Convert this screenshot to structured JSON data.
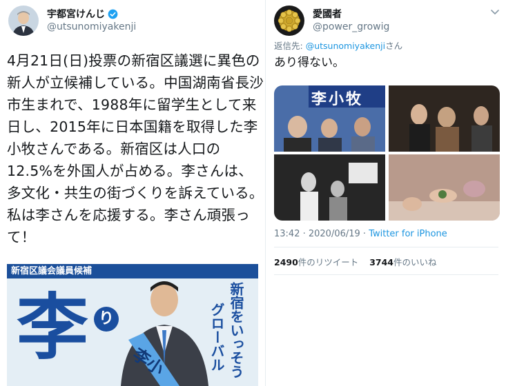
{
  "left_tweet": {
    "display_name": "宇都宮けんじ",
    "handle": "@utsunomiyakenji",
    "text": "4月21日(日)投票の新宿区議選に異色の新人が立候補している。中国湖南省長沙市生まれで、1988年に留学生として来日し、2015年に日本国籍を取得した李小牧さんである。新宿区は人口の12.5%を外国人が占める。李さんは、多文化・共生の街づくりを訴えている。私は李さんを応援する。李さん頑張って！",
    "poster": {
      "band_text": "新宿区議会議員候補",
      "big_char": "李",
      "ri_kana": "り",
      "vertical_text_1": "新宿をいっそう",
      "vertical_text_2": "グローバル",
      "sash_text": "李小"
    }
  },
  "right_tweet": {
    "display_name": "愛國者",
    "handle": "@power_growig",
    "reply_prefix": "返信先: ",
    "reply_handle": "@utsunomiyakenji",
    "reply_suffix": "さん",
    "text": "あり得ない。",
    "media": {
      "banner_text": "李小牧"
    },
    "timestamp": "13:42 · 2020/06/19 · ",
    "source": "Twitter for iPhone",
    "retweets_count": "2490",
    "retweets_label": "件のリツイート",
    "likes_count": "3744",
    "likes_label": "件のいいね"
  },
  "colors": {
    "link": "#1b95e0",
    "verified": "#1da1f2",
    "secondary_text": "#657786",
    "poster_blue": "#1a4e9f"
  }
}
